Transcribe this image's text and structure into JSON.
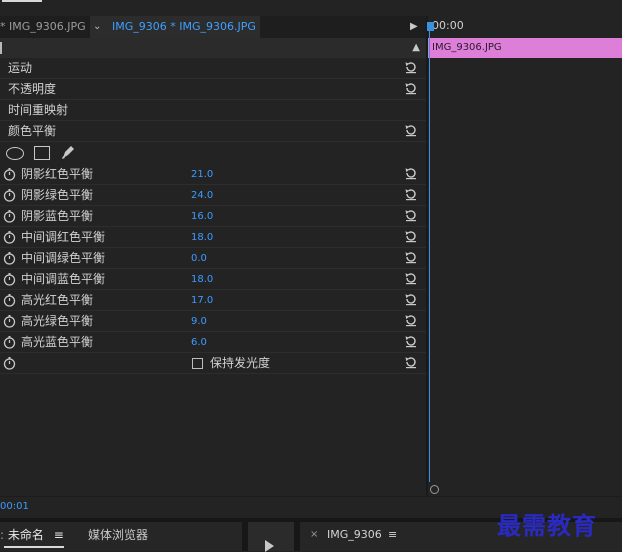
{
  "tabs": [
    {
      "label": "* IMG_9306.JPG"
    },
    {
      "label": "IMG_9306 * IMG_9306.JPG"
    }
  ],
  "effects": [
    {
      "label": "运动"
    },
    {
      "label": "不透明度"
    },
    {
      "label": "时间重映射"
    },
    {
      "label": "颜色平衡"
    }
  ],
  "params": [
    {
      "label": "阴影红色平衡",
      "value": "21.0"
    },
    {
      "label": "阴影绿色平衡",
      "value": "24.0"
    },
    {
      "label": "阴影蓝色平衡",
      "value": "16.0"
    },
    {
      "label": "中间调红色平衡",
      "value": "18.0"
    },
    {
      "label": "中间调绿色平衡",
      "value": "0.0"
    },
    {
      "label": "中间调蓝色平衡",
      "value": "18.0"
    },
    {
      "label": "高光红色平衡",
      "value": "17.0"
    },
    {
      "label": "高光绿色平衡",
      "value": "9.0"
    },
    {
      "label": "高光蓝色平衡",
      "value": "6.0"
    }
  ],
  "preserve_luminosity": {
    "label": "保持发光度",
    "checked": false
  },
  "timeline": {
    "ruler_timecode": "00:00",
    "clip_label": "IMG_9306.JPG"
  },
  "current_timecode": "00:01",
  "bottom_tabs": {
    "project": "未命名",
    "media_browser": "媒体浏览器",
    "program": "IMG_9306",
    "close": "×",
    "menu": "≡"
  },
  "watermark": "最需教育",
  "colors": {
    "accent": "#3e9bff",
    "clip": "#dd7ed9",
    "playhead": "#3d8fdf"
  },
  "icons": {
    "reset": "reset-icon",
    "stopwatch": "stopwatch-icon",
    "ellipse_mask": "ellipse-mask-icon",
    "rect_mask": "rectangle-mask-icon",
    "pen_mask": "pen-mask-icon"
  }
}
